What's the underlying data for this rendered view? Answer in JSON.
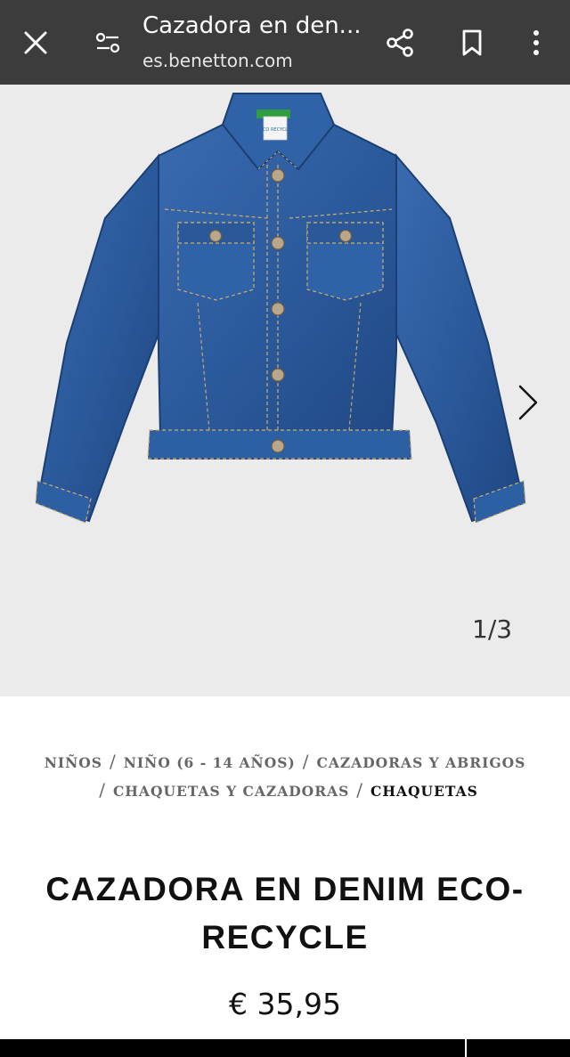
{
  "browser": {
    "title": "Cazadora en den...",
    "url": "es.benetton.com",
    "icons": [
      "close-icon",
      "page-settings-icon",
      "share-icon",
      "bookmark-icon",
      "more-vert-icon"
    ]
  },
  "gallery": {
    "counter": "1/3",
    "current_image": 1,
    "total_images": 3,
    "background_color": "#ebebeb",
    "denim_color": "#2b5a9c",
    "tag_text": "ECO RECYCLE"
  },
  "breadcrumb": {
    "separator": "/",
    "items": [
      {
        "label": "NIÑOS"
      },
      {
        "label": "NIÑO (6 - 14 AÑOS)"
      },
      {
        "label": "CAZADORAS Y ABRIGOS"
      },
      {
        "label": "CHAQUETAS Y CAZADORAS"
      },
      {
        "label": "CHAQUETAS"
      }
    ]
  },
  "product": {
    "title": "CAZADORA EN DENIM ECO-RECYCLE",
    "price": "€ 35,95"
  }
}
